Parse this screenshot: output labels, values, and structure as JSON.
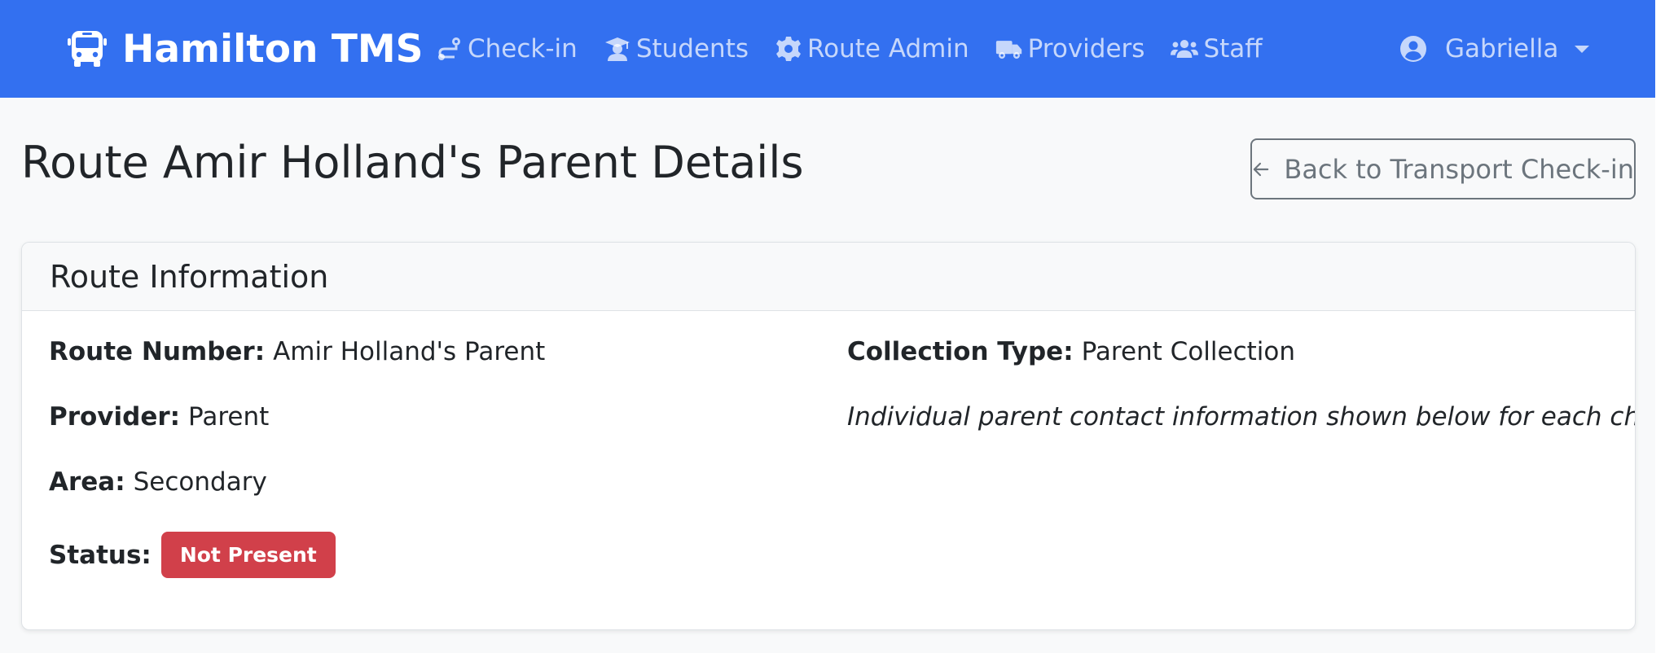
{
  "app": {
    "brand": "Hamilton TMS"
  },
  "nav": {
    "items": [
      {
        "label": "Check-in",
        "icon": "route-icon"
      },
      {
        "label": "Students",
        "icon": "graduate-icon"
      },
      {
        "label": "Route Admin",
        "icon": "gear-icon"
      },
      {
        "label": "Providers",
        "icon": "truck-icon"
      },
      {
        "label": "Staff",
        "icon": "users-icon"
      }
    ],
    "user": "Gabriella"
  },
  "page": {
    "title": "Route Amir Holland's Parent Details",
    "back_label": "Back to Transport Check-in"
  },
  "card": {
    "header": "Route Information",
    "route_number_label": "Route Number:",
    "route_number_value": "Amir Holland's Parent",
    "provider_label": "Provider:",
    "provider_value": "Parent",
    "area_label": "Area:",
    "area_value": "Secondary",
    "status_label": "Status:",
    "status_value": "Not Present",
    "collection_type_label": "Collection Type:",
    "collection_type_value": "Parent Collection",
    "note": "Individual parent contact information shown below for each child"
  },
  "colors": {
    "navbar": "#3370f0",
    "status_danger": "#d1404a",
    "secondary": "#6c757d"
  }
}
